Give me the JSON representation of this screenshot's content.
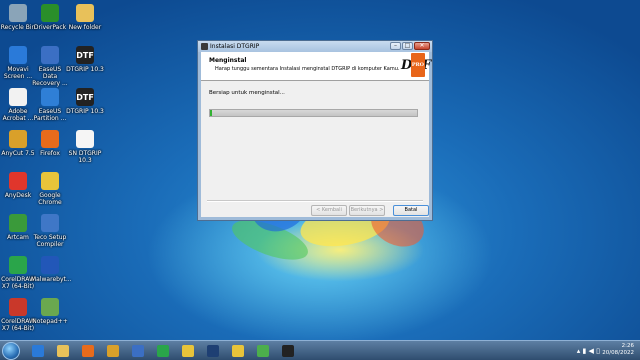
{
  "desktop": {
    "icons": [
      {
        "label": "Recycle Bin",
        "icon": "recycle-bin-icon",
        "color": "#8aa4b8",
        "glyph": ""
      },
      {
        "label": "DriverPack",
        "icon": "driverpack-icon",
        "color": "#2a8f2a",
        "glyph": ""
      },
      {
        "label": "New folder",
        "icon": "folder-icon",
        "color": "#e8c15a",
        "glyph": ""
      },
      {
        "label": "Movavi Screen ...",
        "icon": "movavi-icon",
        "color": "#2a7ad9",
        "glyph": ""
      },
      {
        "label": "EaseUS Data Recovery ...",
        "icon": "easeus-icon",
        "color": "#3b6fc4",
        "glyph": ""
      },
      {
        "label": "DTGRIP 10.3",
        "icon": "dtf-icon",
        "color": "#222222",
        "glyph": "DTF"
      },
      {
        "label": "Adobe Acrobat ...",
        "icon": "acrobat-icon",
        "color": "#f2f2f2",
        "glyph": ""
      },
      {
        "label": "EaseUS Partition ...",
        "icon": "easeus-partition-icon",
        "color": "#2f7fd6",
        "glyph": ""
      },
      {
        "label": "DTGRIP 10.3",
        "icon": "dtf-icon",
        "color": "#222222",
        "glyph": "DTF"
      },
      {
        "label": "AnyCut 7.5",
        "icon": "anycut-icon",
        "color": "#d9a02a",
        "glyph": ""
      },
      {
        "label": "Firefox",
        "icon": "firefox-icon",
        "color": "#e76b1c",
        "glyph": ""
      },
      {
        "label": "SN DTGRIP 10.3",
        "icon": "text-file-icon",
        "color": "#f5f5f5",
        "glyph": ""
      },
      {
        "label": "AnyDesk",
        "icon": "anydesk-icon",
        "color": "#e0362c",
        "glyph": ""
      },
      {
        "label": "Google Chrome",
        "icon": "chrome-icon",
        "color": "#e8c43a",
        "glyph": ""
      },
      {
        "label": "Artcam",
        "icon": "artcam-icon",
        "color": "#3a9a3a",
        "glyph": ""
      },
      {
        "label": "Teco Setup Compiler",
        "icon": "setup-icon",
        "color": "#3f77c7",
        "glyph": ""
      },
      {
        "label": "CorelDRAW X7 (64-Bit)",
        "icon": "coreldraw-icon",
        "color": "#2aa54a",
        "glyph": ""
      },
      {
        "label": "Malwarebyt...",
        "icon": "malwarebytes-icon",
        "color": "#2257b8",
        "glyph": ""
      },
      {
        "label": "CorelDRAW X7 (64-Bit)",
        "icon": "coreldraw-icon",
        "color": "#c9382a",
        "glyph": ""
      },
      {
        "label": "Notepad++",
        "icon": "notepad-icon",
        "color": "#6aa84f",
        "glyph": ""
      }
    ]
  },
  "window": {
    "title": "Instalasi DTGRIP",
    "header_title": "Menginstal",
    "header_subtitle": "Harap tunggu sementara Instalasi menginstal DTGRIP  di komputer Kamu.",
    "logo_text": "DTF",
    "logo_badge": "PRO",
    "status_text": "Bersiap untuk menginstal...",
    "progress_fraction": 0.01,
    "buttons": {
      "back": "< Kembali",
      "next": "Berikutnya >",
      "cancel": "Batal"
    },
    "controls": {
      "minimize": "–",
      "maximize": "□",
      "close": "✕"
    }
  },
  "taskbar": {
    "apps": [
      {
        "icon": "ie-icon",
        "color": "#2a7ad9"
      },
      {
        "icon": "explorer-icon",
        "color": "#e8c15a"
      },
      {
        "icon": "media-player-icon",
        "color": "#e76b1c"
      },
      {
        "icon": "anycut-icon",
        "color": "#d9a02a"
      },
      {
        "icon": "word-icon",
        "color": "#3b6fc4"
      },
      {
        "icon": "coreldraw-icon",
        "color": "#2aa54a"
      },
      {
        "icon": "chrome-icon",
        "color": "#e8c43a"
      },
      {
        "icon": "photoshop-icon",
        "color": "#1e3f73"
      },
      {
        "icon": "chrome-icon",
        "color": "#e8c43a"
      },
      {
        "icon": "greenshot-icon",
        "color": "#4cae4c"
      },
      {
        "icon": "dtf-icon",
        "color": "#222222"
      }
    ],
    "clock_time": "2:26",
    "clock_date": "20/08/2022"
  }
}
